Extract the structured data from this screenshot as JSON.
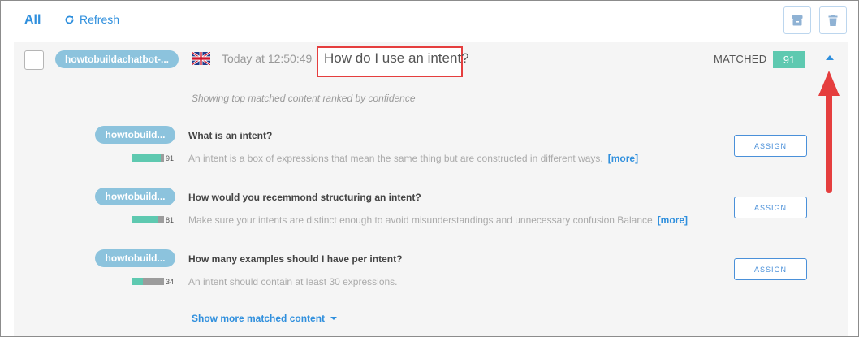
{
  "toolbar": {
    "filter_all": "All",
    "refresh_label": "Refresh"
  },
  "message": {
    "bot_tag": "howtobuildachatbot-...",
    "flag_icon": "uk-flag-icon",
    "timestamp": "Today at 12:50:49",
    "question": "How do I use an intent?",
    "status_label": "MATCHED",
    "score": "91"
  },
  "matches_caption": "Showing top matched content ranked by confidence",
  "matches": [
    {
      "bot_tag": "howtobuild...",
      "title": "What is an intent?",
      "snippet": "An intent is a box of expressions that mean the same thing but are constructed in different ways.",
      "more_label": "[more]",
      "score": "91",
      "confidence": 0.91,
      "assign_label": "ASSIGN"
    },
    {
      "bot_tag": "howtobuild...",
      "title": "How would you recemmond structuring an intent?",
      "snippet": "Make sure your intents are distinct enough to avoid misunderstandings and unnecessary confusion Balance",
      "more_label": "[more]",
      "score": "81",
      "confidence": 0.81,
      "assign_label": "ASSIGN"
    },
    {
      "bot_tag": "howtobuild...",
      "title": "How many examples should I have per intent?",
      "snippet": "An intent should contain at least 30 expressions.",
      "more_label": "",
      "score": "34",
      "confidence": 0.34,
      "assign_label": "ASSIGN"
    }
  ],
  "show_more_label": "Show more matched content",
  "colors": {
    "accent": "#2f8fdd",
    "score_green": "#5ec9b0",
    "tag_blue": "#8cc3dd",
    "highlight_red": "#e53e3e"
  }
}
